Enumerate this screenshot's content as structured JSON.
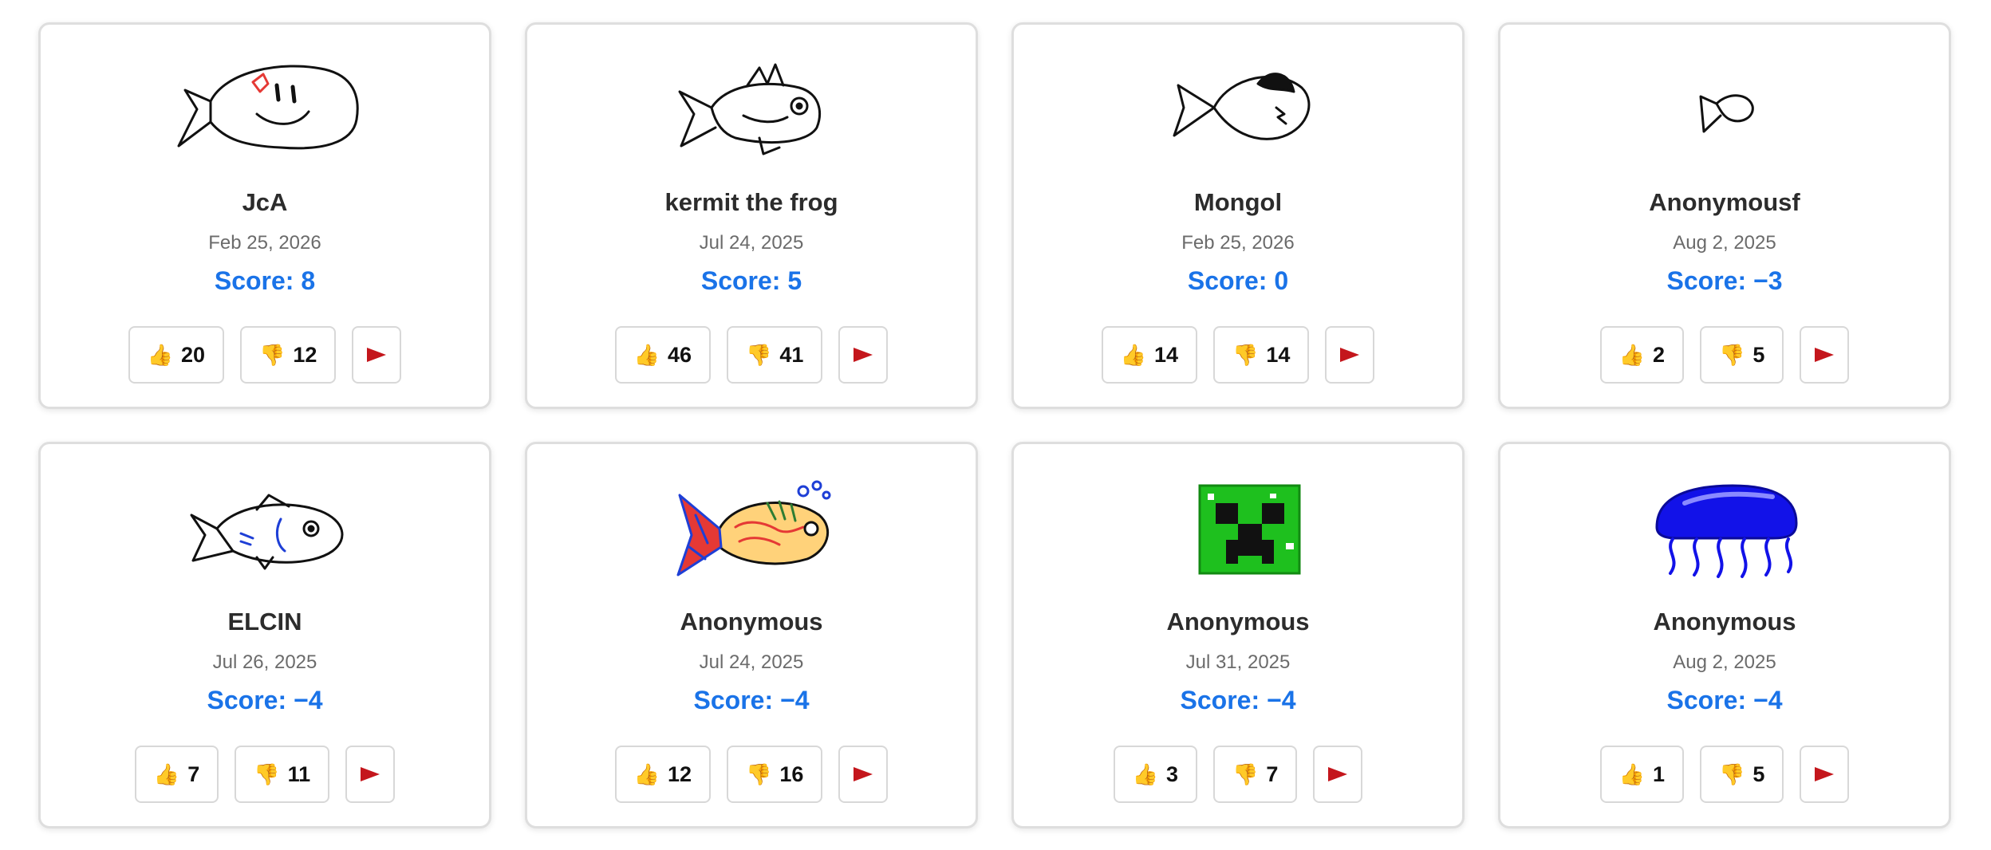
{
  "cards": [
    {
      "name": "JcA",
      "date": "Feb 25, 2026",
      "score": "Score: 8",
      "up": "20",
      "down": "12",
      "drawing": "fish-with-heart"
    },
    {
      "name": "kermit the frog",
      "date": "Jul 24, 2025",
      "score": "Score: 5",
      "up": "46",
      "down": "41",
      "drawing": "spiky-fish"
    },
    {
      "name": "Mongol",
      "date": "Feb 25, 2026",
      "score": "Score: 0",
      "up": "14",
      "down": "14",
      "drawing": "round-fish"
    },
    {
      "name": "Anonymousf",
      "date": "Aug 2, 2025",
      "score": "Score: −3",
      "up": "2",
      "down": "5",
      "drawing": "tiny-fish"
    },
    {
      "name": "ELCIN",
      "date": "Jul 26, 2025",
      "score": "Score: −4",
      "up": "7",
      "down": "11",
      "drawing": "smiling-fish"
    },
    {
      "name": "Anonymous",
      "date": "Jul 24, 2025",
      "score": "Score: −4",
      "up": "12",
      "down": "16",
      "drawing": "colorful-fish"
    },
    {
      "name": "Anonymous",
      "date": "Jul 31, 2025",
      "score": "Score: −4",
      "up": "3",
      "down": "7",
      "drawing": "creeper-face"
    },
    {
      "name": "Anonymous",
      "date": "Aug 2, 2025",
      "score": "Score: −4",
      "up": "1",
      "down": "5",
      "drawing": "blue-jellyfish"
    }
  ],
  "icons": {
    "upvote": "thumbs-up-icon",
    "downvote": "thumbs-down-icon",
    "report": "flag-icon"
  },
  "colors": {
    "score": "#1a73e8",
    "flag": "#c4161c",
    "card_border": "#dedede"
  }
}
